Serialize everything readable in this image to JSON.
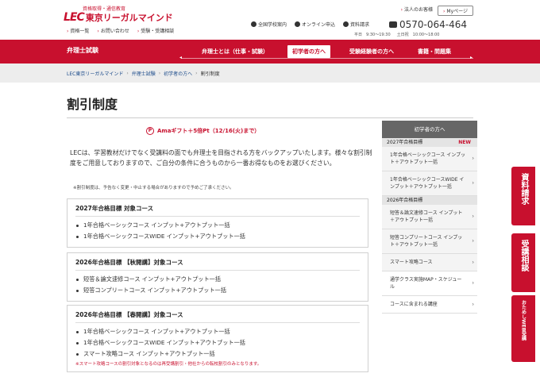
{
  "header": {
    "logo_tagline": "資格取得・通信教育",
    "logo_mark": "LEC",
    "logo_text": "東京リーガルマインド",
    "links": [
      "資格一覧",
      "お問い合わせ",
      "受験・受講相談"
    ],
    "corp_link": "法人のお客様",
    "mypage": "Myページ",
    "utilities": [
      "全国学校案内",
      "オンライン申込",
      "資料請求"
    ],
    "phone": "0570-064-464",
    "hours": [
      "平日　9:30〜19:30",
      "土日祝　10:00〜18:00"
    ]
  },
  "nav": {
    "title": "弁理士試験",
    "items": [
      "弁理士とは（仕事・試験）",
      "初学者の方へ",
      "受験経験者の方へ",
      "書籍・問題集"
    ]
  },
  "breadcrumb": [
    "LEC東京リーガルマインド",
    "弁理士試験",
    "初学者の方へ",
    "割引制度"
  ],
  "page_title": "割引制度",
  "promo": "Amaギフト＋5倍Pt（12/16(火)まで）",
  "intro": "LECは、学習教材だけでなく受講料の面でも弁理士を目指される方をバックアップいたします。様々な割引制度をご用意しておりますので、ご自分の条件に合うものから一番お得なものをお選びください。",
  "note": "※割引制度は、予告なく変更・中止する場合がありますので予めご了承ください。",
  "boxes": [
    {
      "title": "2027年合格目標 対象コース",
      "items": [
        "1年合格ベーシックコース インプット+アウトプット一括",
        "1年合格ベーシックコースWIDE インプット+アウトプット一括"
      ]
    },
    {
      "title": "2026年合格目標 【秋開講】対象コース",
      "items": [
        "短答＆論文速修コース インプット+アウトプット一括",
        "短答コンプリートコース インプット+アウトプット一括"
      ]
    },
    {
      "title": "2026年合格目標 【春開講】対象コース",
      "items": [
        "1年合格ベーシックコース インプット+アウトプット一括",
        "1年合格ベーシックコースWIDE インプット+アウトプット一括",
        "スマート攻略コース インプット+アウトプット一括"
      ],
      "note": "※スマート攻略コースの割引対象となるのは再受講割引・他社からの転校割引のみとなります。"
    }
  ],
  "sidebar": {
    "head": "初学者の方へ",
    "cat1": "2027年合格目標",
    "new_badge": "NEW",
    "cat1_items": [
      "1年合格ベーシックコース インプット＋アウトプット一括",
      "1年合格ベーシックコースWIDE インプット＋アウトプット一括"
    ],
    "cat2": "2026年合格目標",
    "cat2_items": [
      "短答＆論文速修コース インプット＋アウトプット一括",
      "短答コンプリートコース インプット＋アウトプット一括",
      "スマート攻略コース"
    ],
    "other_items": [
      "通学クラス実施MAP・スケジュール",
      "コースに含まれる講座"
    ]
  },
  "cta": {
    "materials": "資料請求",
    "consult": "受講相談",
    "trial": "おためしWEB受講"
  },
  "colors": {
    "brand": "#c8102e"
  }
}
